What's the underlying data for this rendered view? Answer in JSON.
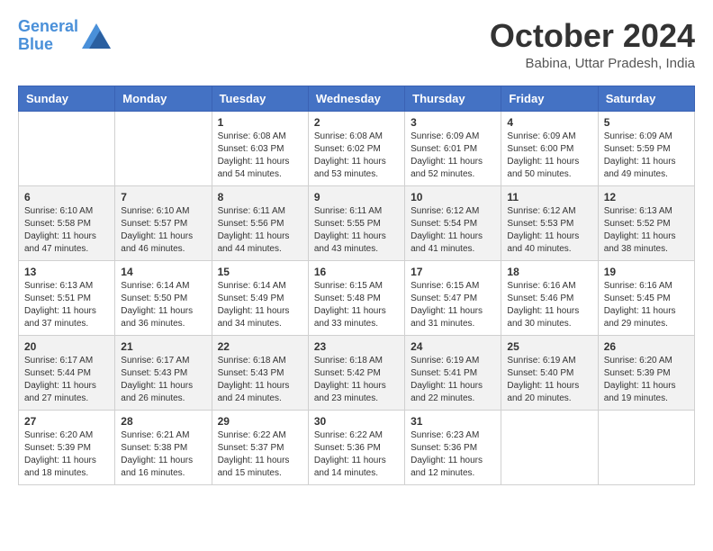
{
  "header": {
    "logo_line1": "General",
    "logo_line2": "Blue",
    "month_title": "October 2024",
    "location": "Babina, Uttar Pradesh, India"
  },
  "weekdays": [
    "Sunday",
    "Monday",
    "Tuesday",
    "Wednesday",
    "Thursday",
    "Friday",
    "Saturday"
  ],
  "weeks": [
    [
      {
        "day": "",
        "sunrise": "",
        "sunset": "",
        "daylight": ""
      },
      {
        "day": "",
        "sunrise": "",
        "sunset": "",
        "daylight": ""
      },
      {
        "day": "1",
        "sunrise": "Sunrise: 6:08 AM",
        "sunset": "Sunset: 6:03 PM",
        "daylight": "Daylight: 11 hours and 54 minutes."
      },
      {
        "day": "2",
        "sunrise": "Sunrise: 6:08 AM",
        "sunset": "Sunset: 6:02 PM",
        "daylight": "Daylight: 11 hours and 53 minutes."
      },
      {
        "day": "3",
        "sunrise": "Sunrise: 6:09 AM",
        "sunset": "Sunset: 6:01 PM",
        "daylight": "Daylight: 11 hours and 52 minutes."
      },
      {
        "day": "4",
        "sunrise": "Sunrise: 6:09 AM",
        "sunset": "Sunset: 6:00 PM",
        "daylight": "Daylight: 11 hours and 50 minutes."
      },
      {
        "day": "5",
        "sunrise": "Sunrise: 6:09 AM",
        "sunset": "Sunset: 5:59 PM",
        "daylight": "Daylight: 11 hours and 49 minutes."
      }
    ],
    [
      {
        "day": "6",
        "sunrise": "Sunrise: 6:10 AM",
        "sunset": "Sunset: 5:58 PM",
        "daylight": "Daylight: 11 hours and 47 minutes."
      },
      {
        "day": "7",
        "sunrise": "Sunrise: 6:10 AM",
        "sunset": "Sunset: 5:57 PM",
        "daylight": "Daylight: 11 hours and 46 minutes."
      },
      {
        "day": "8",
        "sunrise": "Sunrise: 6:11 AM",
        "sunset": "Sunset: 5:56 PM",
        "daylight": "Daylight: 11 hours and 44 minutes."
      },
      {
        "day": "9",
        "sunrise": "Sunrise: 6:11 AM",
        "sunset": "Sunset: 5:55 PM",
        "daylight": "Daylight: 11 hours and 43 minutes."
      },
      {
        "day": "10",
        "sunrise": "Sunrise: 6:12 AM",
        "sunset": "Sunset: 5:54 PM",
        "daylight": "Daylight: 11 hours and 41 minutes."
      },
      {
        "day": "11",
        "sunrise": "Sunrise: 6:12 AM",
        "sunset": "Sunset: 5:53 PM",
        "daylight": "Daylight: 11 hours and 40 minutes."
      },
      {
        "day": "12",
        "sunrise": "Sunrise: 6:13 AM",
        "sunset": "Sunset: 5:52 PM",
        "daylight": "Daylight: 11 hours and 38 minutes."
      }
    ],
    [
      {
        "day": "13",
        "sunrise": "Sunrise: 6:13 AM",
        "sunset": "Sunset: 5:51 PM",
        "daylight": "Daylight: 11 hours and 37 minutes."
      },
      {
        "day": "14",
        "sunrise": "Sunrise: 6:14 AM",
        "sunset": "Sunset: 5:50 PM",
        "daylight": "Daylight: 11 hours and 36 minutes."
      },
      {
        "day": "15",
        "sunrise": "Sunrise: 6:14 AM",
        "sunset": "Sunset: 5:49 PM",
        "daylight": "Daylight: 11 hours and 34 minutes."
      },
      {
        "day": "16",
        "sunrise": "Sunrise: 6:15 AM",
        "sunset": "Sunset: 5:48 PM",
        "daylight": "Daylight: 11 hours and 33 minutes."
      },
      {
        "day": "17",
        "sunrise": "Sunrise: 6:15 AM",
        "sunset": "Sunset: 5:47 PM",
        "daylight": "Daylight: 11 hours and 31 minutes."
      },
      {
        "day": "18",
        "sunrise": "Sunrise: 6:16 AM",
        "sunset": "Sunset: 5:46 PM",
        "daylight": "Daylight: 11 hours and 30 minutes."
      },
      {
        "day": "19",
        "sunrise": "Sunrise: 6:16 AM",
        "sunset": "Sunset: 5:45 PM",
        "daylight": "Daylight: 11 hours and 29 minutes."
      }
    ],
    [
      {
        "day": "20",
        "sunrise": "Sunrise: 6:17 AM",
        "sunset": "Sunset: 5:44 PM",
        "daylight": "Daylight: 11 hours and 27 minutes."
      },
      {
        "day": "21",
        "sunrise": "Sunrise: 6:17 AM",
        "sunset": "Sunset: 5:43 PM",
        "daylight": "Daylight: 11 hours and 26 minutes."
      },
      {
        "day": "22",
        "sunrise": "Sunrise: 6:18 AM",
        "sunset": "Sunset: 5:43 PM",
        "daylight": "Daylight: 11 hours and 24 minutes."
      },
      {
        "day": "23",
        "sunrise": "Sunrise: 6:18 AM",
        "sunset": "Sunset: 5:42 PM",
        "daylight": "Daylight: 11 hours and 23 minutes."
      },
      {
        "day": "24",
        "sunrise": "Sunrise: 6:19 AM",
        "sunset": "Sunset: 5:41 PM",
        "daylight": "Daylight: 11 hours and 22 minutes."
      },
      {
        "day": "25",
        "sunrise": "Sunrise: 6:19 AM",
        "sunset": "Sunset: 5:40 PM",
        "daylight": "Daylight: 11 hours and 20 minutes."
      },
      {
        "day": "26",
        "sunrise": "Sunrise: 6:20 AM",
        "sunset": "Sunset: 5:39 PM",
        "daylight": "Daylight: 11 hours and 19 minutes."
      }
    ],
    [
      {
        "day": "27",
        "sunrise": "Sunrise: 6:20 AM",
        "sunset": "Sunset: 5:39 PM",
        "daylight": "Daylight: 11 hours and 18 minutes."
      },
      {
        "day": "28",
        "sunrise": "Sunrise: 6:21 AM",
        "sunset": "Sunset: 5:38 PM",
        "daylight": "Daylight: 11 hours and 16 minutes."
      },
      {
        "day": "29",
        "sunrise": "Sunrise: 6:22 AM",
        "sunset": "Sunset: 5:37 PM",
        "daylight": "Daylight: 11 hours and 15 minutes."
      },
      {
        "day": "30",
        "sunrise": "Sunrise: 6:22 AM",
        "sunset": "Sunset: 5:36 PM",
        "daylight": "Daylight: 11 hours and 14 minutes."
      },
      {
        "day": "31",
        "sunrise": "Sunrise: 6:23 AM",
        "sunset": "Sunset: 5:36 PM",
        "daylight": "Daylight: 11 hours and 12 minutes."
      },
      {
        "day": "",
        "sunrise": "",
        "sunset": "",
        "daylight": ""
      },
      {
        "day": "",
        "sunrise": "",
        "sunset": "",
        "daylight": ""
      }
    ]
  ]
}
